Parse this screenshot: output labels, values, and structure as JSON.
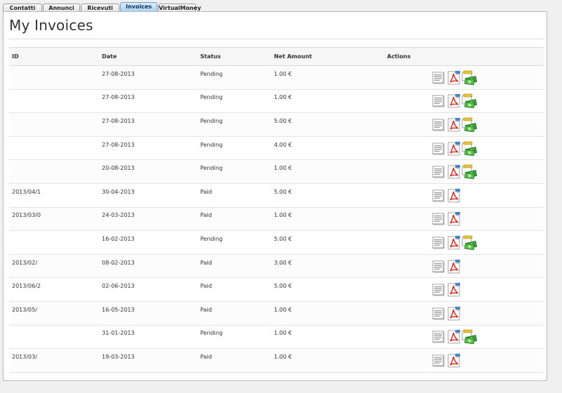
{
  "tabs": [
    {
      "label": "Contatti",
      "active": false
    },
    {
      "label": "Annunci",
      "active": false
    },
    {
      "label": "Ricevuti",
      "active": false
    },
    {
      "label": "Invoices",
      "active": true
    },
    {
      "label": "VirtualMoney",
      "active": false
    }
  ],
  "page_title": "My Invoices",
  "table": {
    "headers": {
      "id": "ID",
      "date": "Date",
      "status": "Status",
      "net_amount": "Net Amount",
      "actions": "Actions"
    },
    "rows": [
      {
        "id": "",
        "date": "27-08-2013",
        "status": "Pending",
        "amount": "1.00 €",
        "pay": true
      },
      {
        "id": "",
        "date": "27-08-2013",
        "status": "Pending",
        "amount": "1.00 €",
        "pay": true
      },
      {
        "id": "",
        "date": "27-08-2013",
        "status": "Pending",
        "amount": "5.00 €",
        "pay": true
      },
      {
        "id": "",
        "date": "27-08-2013",
        "status": "Pending",
        "amount": "4.00 €",
        "pay": true
      },
      {
        "id": "",
        "date": "20-08-2013",
        "status": "Pending",
        "amount": "1.00 €",
        "pay": true
      },
      {
        "id": "2013/04/1",
        "date": "30-04-2013",
        "status": "Paid",
        "amount": "5.00 €",
        "pay": false
      },
      {
        "id": "2013/03/0",
        "date": "24-03-2013",
        "status": "Paid",
        "amount": "1.00 €",
        "pay": false
      },
      {
        "id": "",
        "date": "16-02-2013",
        "status": "Pending",
        "amount": "5.00 €",
        "pay": true
      },
      {
        "id": "2013/02/",
        "date": "08-02-2013",
        "status": "Paid",
        "amount": "3.00 €",
        "pay": false
      },
      {
        "id": "2013/06/2",
        "date": "02-06-2013",
        "status": "Paid",
        "amount": "5.00 €",
        "pay": false
      },
      {
        "id": "2013/05/",
        "date": "16-05-2013",
        "status": "Paid",
        "amount": "1.00 €",
        "pay": false
      },
      {
        "id": "",
        "date": "31-01-2013",
        "status": "Pending",
        "amount": "1.00 €",
        "pay": true
      },
      {
        "id": "2013/03/",
        "date": "19-03-2013",
        "status": "Paid",
        "amount": "1.00 €",
        "pay": false
      }
    ]
  },
  "icons": {
    "view": "document-view-icon",
    "pdf": "pdf-download-icon",
    "pay": "pay-money-icon"
  },
  "colors": {
    "active_tab": "#a8d0f5",
    "pdf_red": "#d0261e",
    "money_green": "#3aa23a"
  }
}
